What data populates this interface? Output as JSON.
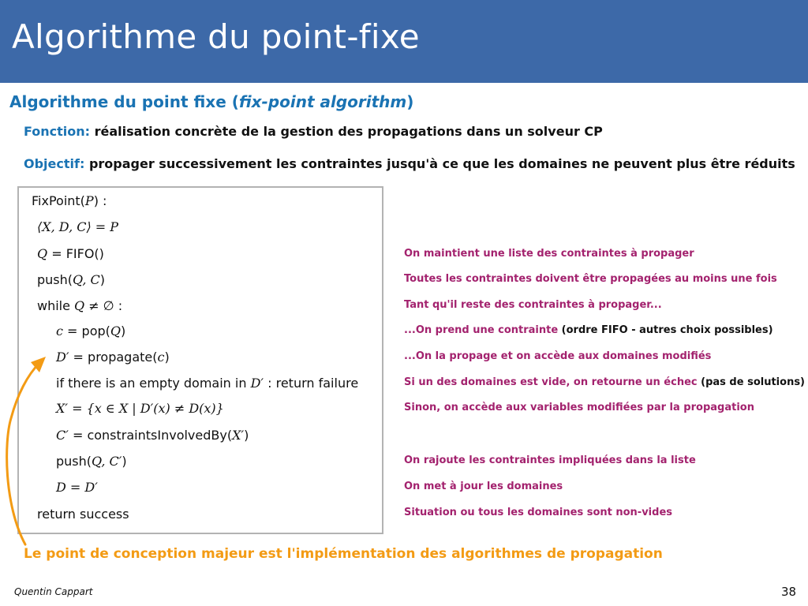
{
  "slide": {
    "title": "Algorithme du point-fixe",
    "heading_main": "Algorithme du point fixe (",
    "heading_italic": "fix-point algorithm",
    "heading_close": ")",
    "function_key": "Fonction:",
    "function_text": " réalisation concrète de la gestion des propagations dans un solveur CP",
    "objective_key": "Objectif:",
    "objective_text": " propager successivement les contraintes jusqu'à ce que les domaines ne peuvent plus être réduits"
  },
  "code": {
    "l1_a": "FixPoint(",
    "l1_b": "P",
    "l1_c": ") :",
    "l2": "⟨X, D, C⟩ = P",
    "l3_a": "Q",
    "l3_b": " = FIFO()",
    "l4_a": "push(",
    "l4_b": "Q, C",
    "l4_c": ")",
    "l5_a": "while ",
    "l5_b": "Q",
    "l5_c": " ≠ ∅ :",
    "l6_a": "c",
    "l6_b": " = pop(",
    "l6_c": "Q",
    "l6_d": ")",
    "l7_a": "D′",
    "l7_b": " = propagate(",
    "l7_c": "c",
    "l7_d": ")",
    "l8_a": "if there is an empty domain in ",
    "l8_b": "D′",
    "l8_c": " : return failure",
    "l9": "X′ = {x ∈ X | D′(x) ≠ D(x)}",
    "l10_a": "C′",
    "l10_b": " = constraintsInvolvedBy(",
    "l10_c": "X′",
    "l10_d": ")",
    "l11_a": "push(",
    "l11_b": "Q, C′",
    "l11_c": ")",
    "l12": "D = D′",
    "l13": "return success"
  },
  "comments": {
    "c1": "On maintient une liste des contraintes à propager",
    "c2": "Toutes les contraintes doivent être propagées au moins une fois",
    "c3": "Tant qu'il reste des contraintes à propager...",
    "c4_a": "...On prend une contrainte",
    "c4_b": " (ordre FIFO - autres choix possibles)",
    "c5": "...On la propage et on accède aux domaines modifiés",
    "c6_a": "Si un des domaines est vide, on retourne un échec",
    "c6_b": " (pas de solutions)",
    "c7": "Sinon, on accède aux variables modifiées par la propagation",
    "c8": "On rajoute les contraintes impliquées dans la liste",
    "c9": "On met à jour les domaines",
    "c10": "Situation ou tous les domaines sont non-vides"
  },
  "conclusion": "Le point de conception majeur est l'implémentation des algorithmes de propagation",
  "footer": {
    "author": "Quentin Cappart",
    "page": "38"
  },
  "colors": {
    "title_bar": "#3d69a8",
    "heading_blue": "#1a73b3",
    "comment_purple": "#a3226e",
    "highlight_orange": "#f39b14"
  }
}
